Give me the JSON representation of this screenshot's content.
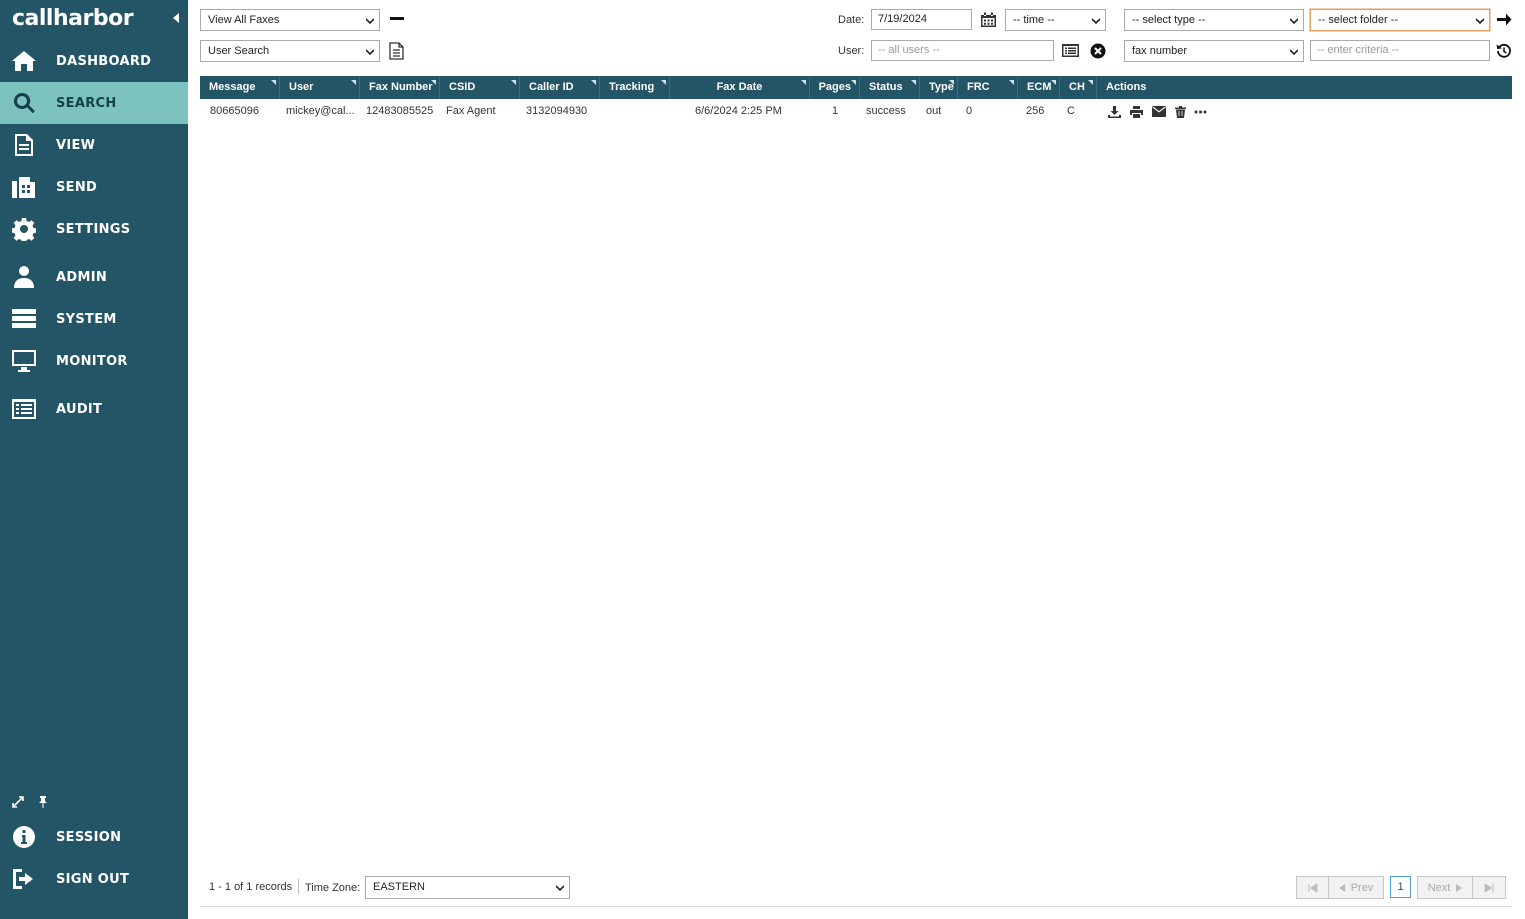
{
  "app": {
    "logo": "callharbor"
  },
  "nav": {
    "items": [
      {
        "label": "DASHBOARD",
        "icon": "home-icon"
      },
      {
        "label": "SEARCH",
        "icon": "search-icon",
        "active": true
      },
      {
        "label": "VIEW",
        "icon": "document-icon"
      },
      {
        "label": "SEND",
        "icon": "fax-icon"
      },
      {
        "label": "SETTINGS",
        "icon": "gear-icon"
      },
      {
        "label": "ADMIN",
        "icon": "user-icon"
      },
      {
        "label": "SYSTEM",
        "icon": "server-icon"
      },
      {
        "label": "MONITOR",
        "icon": "monitor-icon"
      },
      {
        "label": "AUDIT",
        "icon": "list-icon"
      }
    ],
    "bottom": [
      {
        "label": "SESSION",
        "icon": "info-icon"
      },
      {
        "label": "SIGN OUT",
        "icon": "sign-out-icon"
      }
    ]
  },
  "toolbar": {
    "view_select": "View All Faxes",
    "search_select": "User Search",
    "date_label": "Date:",
    "date_value": "7/19/2024",
    "time_select": "-- time --",
    "type_select": "-- select type --",
    "folder_select": "-- select folder --",
    "user_label": "User:",
    "user_placeholder": "-- all users --",
    "field_select": "fax number",
    "criteria_placeholder": "-- enter criteria --"
  },
  "grid": {
    "columns": [
      "Message",
      "User",
      "Fax Number",
      "CSID",
      "Caller ID",
      "Tracking",
      "Fax Date",
      "Pages",
      "Status",
      "Type",
      "FRC",
      "ECM",
      "CH",
      "Actions"
    ],
    "rows": [
      {
        "message": "80665096",
        "user": "mickey@cal...",
        "fax_number": "12483085525",
        "csid": "Fax Agent",
        "caller_id": "3132094930",
        "tracking": "",
        "fax_date": "6/6/2024 2:25 PM",
        "pages": "1",
        "status": "success",
        "type": "out",
        "frc": "0",
        "ecm": "256",
        "ch": "C"
      }
    ]
  },
  "footer": {
    "records": "1 - 1 of 1 records",
    "timezone_label": "Time Zone:",
    "timezone_value": "EASTERN",
    "prev": "Prev",
    "next": "Next",
    "page": "1"
  },
  "colors": {
    "sidebar": "#245566",
    "active": "#7cc3bd",
    "header": "#245566"
  }
}
